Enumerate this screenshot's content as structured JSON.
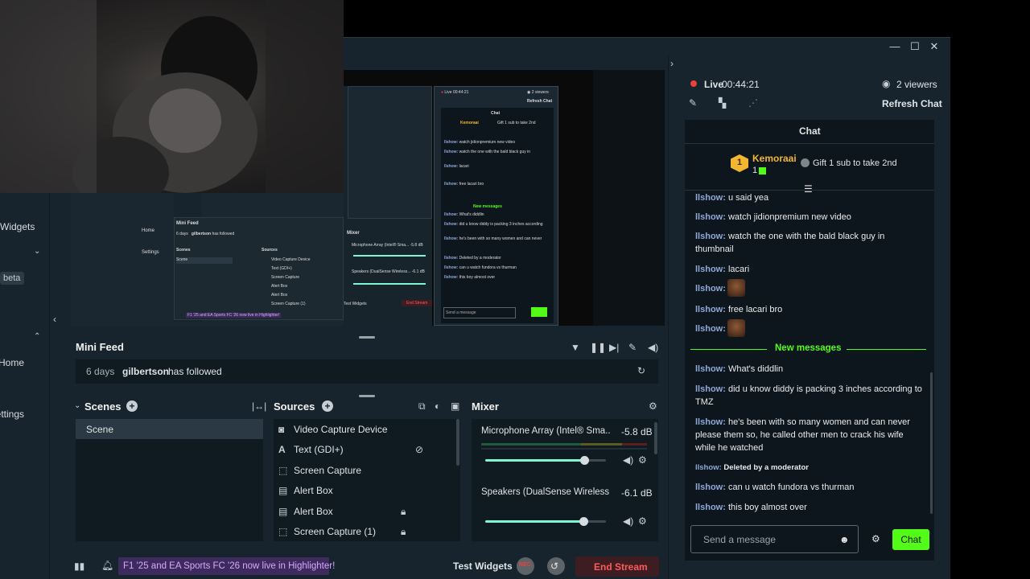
{
  "window": {
    "minimize": "—",
    "maximize": "☐",
    "close": "✕"
  },
  "left_nav": {
    "widgets": "Widgets",
    "beta": "beta",
    "home": "Home",
    "settings": "Settings"
  },
  "mini_feed": {
    "title": "Mini Feed",
    "item": {
      "time": "6 days",
      "user": "gilbertson",
      "action": "has followed"
    }
  },
  "scenes": {
    "title": "Scenes",
    "items": [
      "Scene"
    ]
  },
  "sources": {
    "title": "Sources",
    "items": [
      {
        "label": "Video Capture Device",
        "icon": "webcam-icon"
      },
      {
        "label": "Text (GDI+)",
        "icon": "text-icon"
      },
      {
        "label": "Screen Capture",
        "icon": "screen-capture-icon"
      },
      {
        "label": "Alert Box",
        "icon": "alert-box-icon"
      },
      {
        "label": "Alert Box",
        "icon": "alert-box-icon"
      },
      {
        "label": "Screen Capture (1)",
        "icon": "screen-capture-icon"
      }
    ]
  },
  "mixer": {
    "title": "Mixer",
    "channels": [
      {
        "name": "Microphone Array (Intel® Sma...",
        "db": "-5.8 dB",
        "volume": 0.82
      },
      {
        "name": "Speakers (DualSense Wireless...",
        "db": "-6.1 dB",
        "volume": 0.81
      }
    ]
  },
  "footer": {
    "promo": "F1 '25 and EA Sports FC '26 now live in Highlighter!",
    "test_widgets": "Test Widgets",
    "rec": "REC",
    "end_stream": "End Stream"
  },
  "stream": {
    "live_label": "Live",
    "timer": "00:44:21",
    "viewers": "2 viewers",
    "refresh_chat": "Refresh Chat"
  },
  "chat": {
    "title": "Chat",
    "top_gifter": {
      "rank": "1",
      "name": "Kemoraai",
      "count": "1"
    },
    "gift_prompt": "Gift 1 sub to take 2nd",
    "new_messages_label": "New messages",
    "messages": [
      {
        "user": "llshow",
        "text": "u said yea"
      },
      {
        "user": "llshow",
        "text": "watch jidionpremium new video"
      },
      {
        "user": "llshow",
        "text": "watch the one with the bald black guy in thumbnail"
      },
      {
        "user": "llshow",
        "text": "lacari"
      },
      {
        "user": "llshow",
        "text": ""
      },
      {
        "user": "llshow",
        "text": "free lacari bro"
      },
      {
        "user": "llshow",
        "text": ""
      },
      {
        "user": "llshow",
        "text": "What's diddlin"
      },
      {
        "user": "llshow",
        "text": "did u know diddy is packing 3 inches according to TMZ"
      },
      {
        "user": "llshow",
        "text": "he's been with so many women and can never please them so, he called other men to crack his wife while he watched"
      },
      {
        "user": "llshow",
        "text": "Deleted by a moderator"
      },
      {
        "user": "llshow",
        "text": "can u watch fundora vs thurman"
      },
      {
        "user": "llshow",
        "text": "this boy almost over"
      }
    ],
    "input_placeholder": "Send a message",
    "send_label": "Chat"
  },
  "colors": {
    "accent_green": "#53fc18",
    "live_red": "#e8423a",
    "slider": "#80f5d2",
    "promo_bg": "#3e2b5e",
    "promo_text": "#d9a6ff",
    "end_stream_bg": "#3d1d22",
    "end_stream_text": "#ff5a5a",
    "gifter_gold": "#f2b630"
  }
}
